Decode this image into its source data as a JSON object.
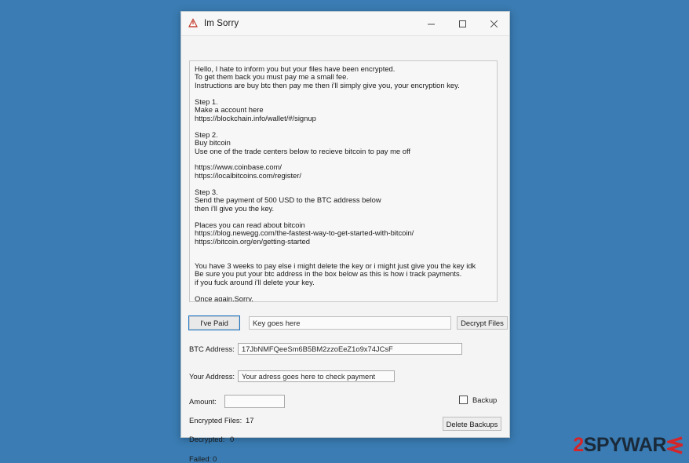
{
  "desktop": {
    "background_color": "#3a7cb3"
  },
  "window": {
    "title": "Im Sorry",
    "icon": "red-triangle-app-icon",
    "controls": {
      "minimize": "minimize-icon",
      "maximize": "maximize-icon",
      "close": "close-icon"
    }
  },
  "note": {
    "text": "Hello, I hate to inform you but your files have been encrypted.\nTo get them back you must pay me a small fee.\nInstructions are buy btc then pay me then i'll simply give you, your encryption key.\n\nStep 1.\nMake a account here\nhttps://blockchain.info/wallet/#/signup\n\nStep 2.\nBuy bitcoin\nUse one of the trade centers below to recieve bitcoin to pay me off\n\nhttps://www.coinbase.com/\nhttps://localbitcoins.com/register/\n\nStep 3.\nSend the payment of 500 USD to the BTC address below\nthen i'll give you the key.\n\nPlaces you can read about bitcoin\nhttps://blog.newegg.com/the-fastest-way-to-get-started-with-bitcoin/\nhttps://bitcoin.org/en/getting-started\n\n\nYou have 3 weeks to pay else i might delete the key or i might just give you the key idk\nBe sure you put your btc address in the box below as this is how i track payments.\nif you fuck around i'll delete your key.\n\nOnce again.Sorry."
  },
  "actions": {
    "ive_paid_label": "I've Paid",
    "key_placeholder": "Key goes here",
    "decrypt_files_label": "Decrypt Files"
  },
  "fields": {
    "btc_address_label": "BTC Address:",
    "btc_address_value": "17JbNMFQeeSm6B5BM2zzoEeZ1o9x74JCsF",
    "your_address_label": "Your Address:",
    "your_address_placeholder": "Your adress goes here to check payment",
    "amount_label": "Amount:",
    "amount_value": ""
  },
  "stats": {
    "encrypted_files_label": "Encrypted Files:",
    "encrypted_files_value": "17",
    "decrypted_label": "Decrypted:",
    "decrypted_value": "0",
    "failed_label": "Failed:",
    "failed_value": "0"
  },
  "backup": {
    "checkbox_label": "Backup",
    "checked": false,
    "delete_backups_label": "Delete Backups"
  },
  "watermark": {
    "part_1": "2",
    "part_2": "SPYWAR",
    "part_3": "E",
    "color_accent": "#d4252b",
    "color_dark": "#1b2a3a"
  }
}
